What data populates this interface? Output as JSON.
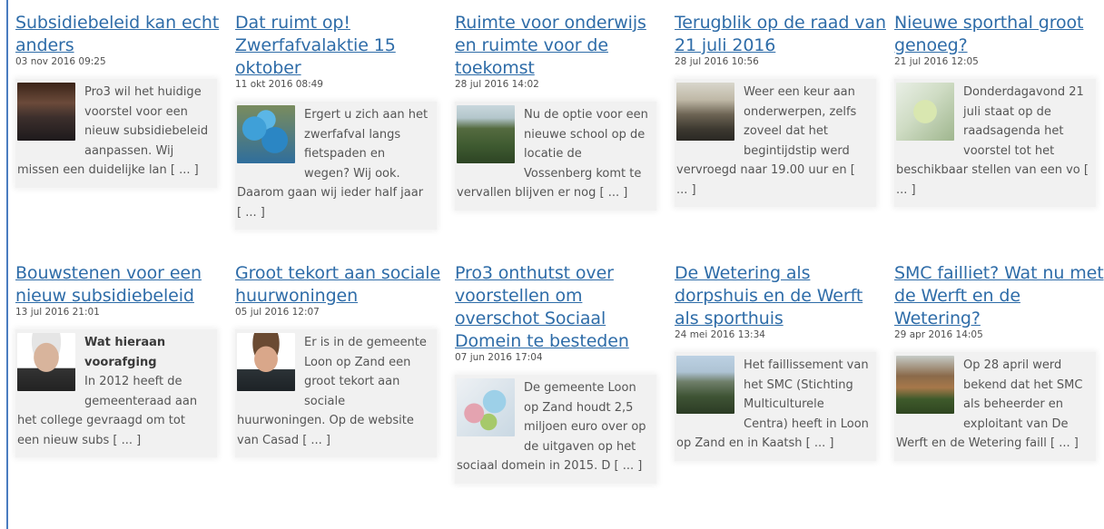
{
  "posts": [
    {
      "title": "Subsidiebeleid kan echt anders",
      "date": "03 nov 2016 09:25",
      "thumb": "crowd-photo",
      "lead": "",
      "text": "Pro3 wil het huidige voorstel voor een nieuw subsidiebeleid aanpassen. Wij missen een duidelijke lan [ ... ]"
    },
    {
      "title": "Dat ruimt op! Zwerfafvalaktie 15 oktober",
      "date": "11 okt 2016 08:49",
      "thumb": "trash-bags-photo",
      "lead": "",
      "text": "Ergert u zich aan het zwerfafval langs fietspaden en wegen? Wij ook. Daarom gaan wij ieder half jaar [ ... ]"
    },
    {
      "title": "Ruimte voor onderwijs en ruimte voor de toekomst",
      "date": "28 jul 2016 14:02",
      "thumb": "field-photo",
      "lead": "",
      "text": "Nu de optie voor een nieuwe school  op de locatie de Vossenberg komt te vervallen blijven er nog  [ ... ]"
    },
    {
      "title": "Terugblik op de raad van 21 juli 2016",
      "date": "28 jul 2016 10:56",
      "thumb": "council-photo",
      "lead": "",
      "text": "Weer een keur aan onderwerpen, zelfs zoveel dat het begintijdstip werd vervroegd naar 19.00 uur en [ ... ]"
    },
    {
      "title": "Nieuwe sporthal groot genoeg?",
      "date": "21 jul 2016 12:05",
      "thumb": "site-map",
      "lead": "",
      "text": "Donderdagavond 21 juli staat op de raadsagenda het voorstel tot het beschikbaar stellen van een vo [ ... ]"
    },
    {
      "title": "Bouwstenen voor een nieuw subsidiebeleid",
      "date": "13 jul 2016 21:01",
      "thumb": "portrait-man-glasses",
      "lead": "Wat hieraan voorafging",
      "text": "In 2012 heeft de gemeenteraad aan het college gevraagd om tot een nieuw subs [ ... ]"
    },
    {
      "title": "Groot tekort aan sociale huurwoningen",
      "date": "05 jul 2016 12:07",
      "thumb": "portrait-young-man",
      "lead": "",
      "text": "Er is in de gemeente Loon op Zand een groot tekort aan sociale huurwoningen. Op de website van Casad [ ... ]"
    },
    {
      "title": "Pro3 onthutst over voorstellen om overschot Sociaal Domein te besteden",
      "date": "07 jun 2016 17:04",
      "thumb": "food-photo",
      "lead": "",
      "text": "De gemeente Loon op Zand houdt 2,5 miljoen euro over op de uitgaven op het sociaal domein in 2015. D [ ... ]"
    },
    {
      "title": "De Wetering als dorpshuis en de Werft als sporthuis",
      "date": "24 mei 2016 13:34",
      "thumb": "building-photo",
      "lead": "",
      "text": "Het faillissement van het SMC (Stichting Multiculturele Centra) heeft in Loon op Zand en in Kaatsh [ ... ]"
    },
    {
      "title": "SMC failliet? Wat nu met de Werft en de Wetering?",
      "date": "29 apr 2016 14:05",
      "thumb": "church-photo",
      "lead": "",
      "text": "Op 28 april werd bekend dat het SMC als beheerder en exploitant van De Werft en de Wetering faill [ ... ]"
    }
  ]
}
